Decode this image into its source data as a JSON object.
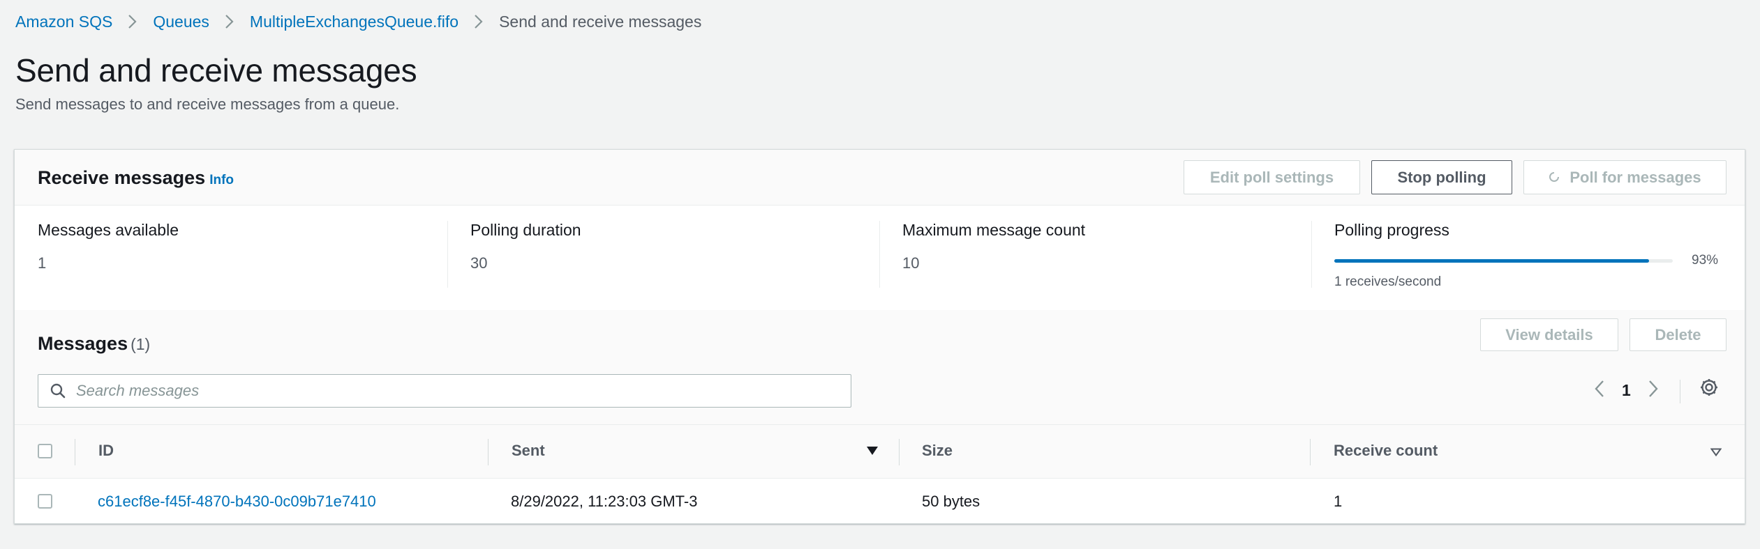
{
  "breadcrumb": {
    "items": [
      "Amazon SQS",
      "Queues",
      "MultipleExchangesQueue.fifo"
    ],
    "current": "Send and receive messages"
  },
  "page": {
    "title": "Send and receive messages",
    "description": "Send messages to and receive messages from a queue."
  },
  "receive": {
    "title": "Receive messages",
    "info": "Info",
    "buttons": {
      "edit_poll": "Edit poll settings",
      "stop_polling": "Stop polling",
      "poll_for_messages": "Poll for messages"
    },
    "stats": {
      "messages_available_label": "Messages available",
      "messages_available_value": "1",
      "polling_duration_label": "Polling duration",
      "polling_duration_value": "30",
      "max_count_label": "Maximum message count",
      "max_count_value": "10",
      "progress_label": "Polling progress",
      "progress_percent": 93,
      "progress_text": "93%",
      "progress_rate": "1 receives/second"
    }
  },
  "messages": {
    "title": "Messages",
    "count": "(1)",
    "buttons": {
      "view_details": "View details",
      "delete": "Delete"
    },
    "search_placeholder": "Search messages",
    "page": "1",
    "columns": {
      "id": "ID",
      "sent": "Sent",
      "size": "Size",
      "receive_count": "Receive count"
    },
    "rows": [
      {
        "id": "c61ecf8e-f45f-4870-b430-0c09b71e7410",
        "sent": "8/29/2022, 11:23:03 GMT-3",
        "size": "50 bytes",
        "receive_count": "1"
      }
    ]
  },
  "colors": {
    "link": "#0073bb",
    "progress": "#0073bb",
    "text": "#16191f",
    "muted": "#545b64"
  },
  "icons": [
    "chevron-right-icon",
    "spinner-icon",
    "search-icon",
    "chevron-left-icon",
    "gear-icon",
    "caret-down-icon"
  ]
}
